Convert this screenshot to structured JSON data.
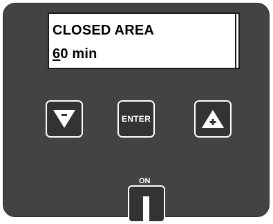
{
  "display": {
    "line1": "CLOSED AREA",
    "line2_cursor_char": "6",
    "line2_rest": "0 min"
  },
  "buttons": {
    "down": {
      "icon": "triangle-down-minus-icon",
      "symbol": "−"
    },
    "enter": {
      "label": "ENTER"
    },
    "up": {
      "icon": "triangle-up-plus-icon",
      "symbol": "+"
    }
  },
  "power": {
    "label": "ON",
    "icon": "power-switch-icon"
  },
  "colors": {
    "panel": "#434343",
    "key_fill": "#333333",
    "key_outline": "#ffffff",
    "lcd_bg": "#ffffff",
    "lcd_text": "#000000"
  }
}
